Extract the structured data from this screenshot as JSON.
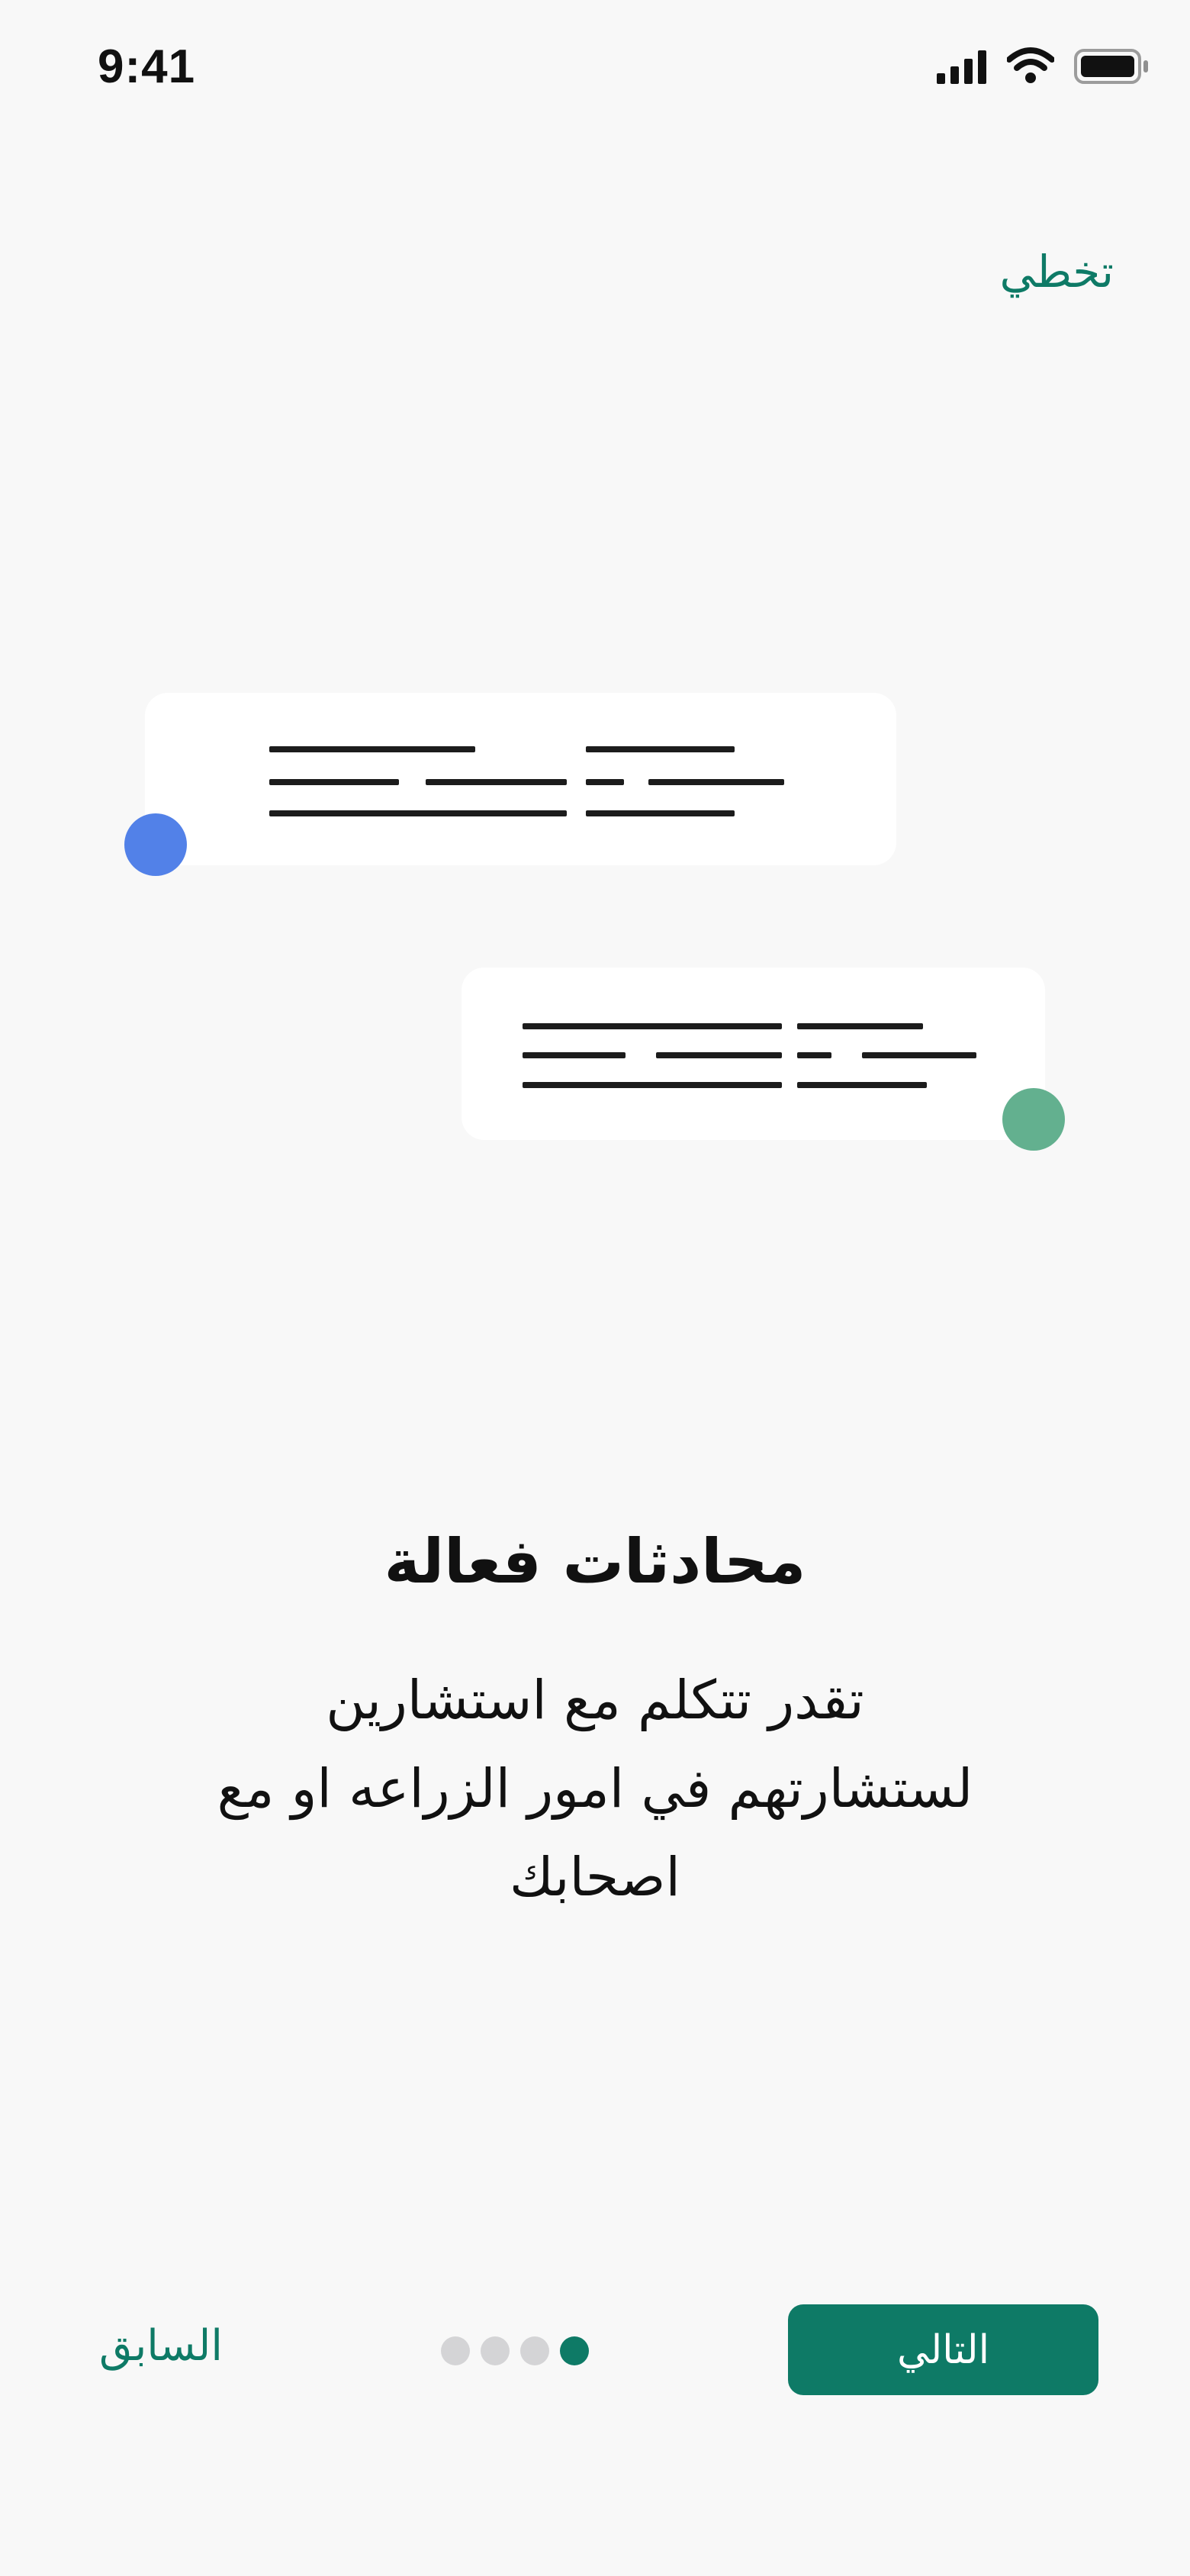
{
  "status_bar": {
    "time": "9:41",
    "icons": [
      "signal-icon",
      "wifi-icon",
      "battery-icon"
    ]
  },
  "header": {
    "skip_label": "تخطي"
  },
  "illustration": {
    "bubbles": [
      {
        "avatar_color": "#5281e8"
      },
      {
        "avatar_color": "#63b08f"
      }
    ]
  },
  "content": {
    "title": "محادثات فعالة",
    "subtitle_lines": [
      "تقدر تتكلم مع استشارين",
      "لستشارتهم في امور الزراعه او مع",
      "اصحابك"
    ]
  },
  "footer": {
    "prev_label": "السابق",
    "next_label": "التالي",
    "page_count": 4,
    "active_page": 1
  },
  "colors": {
    "accent": "#0e7a66",
    "background": "#f8f8f8",
    "dot_inactive": "#d4d4d6"
  }
}
